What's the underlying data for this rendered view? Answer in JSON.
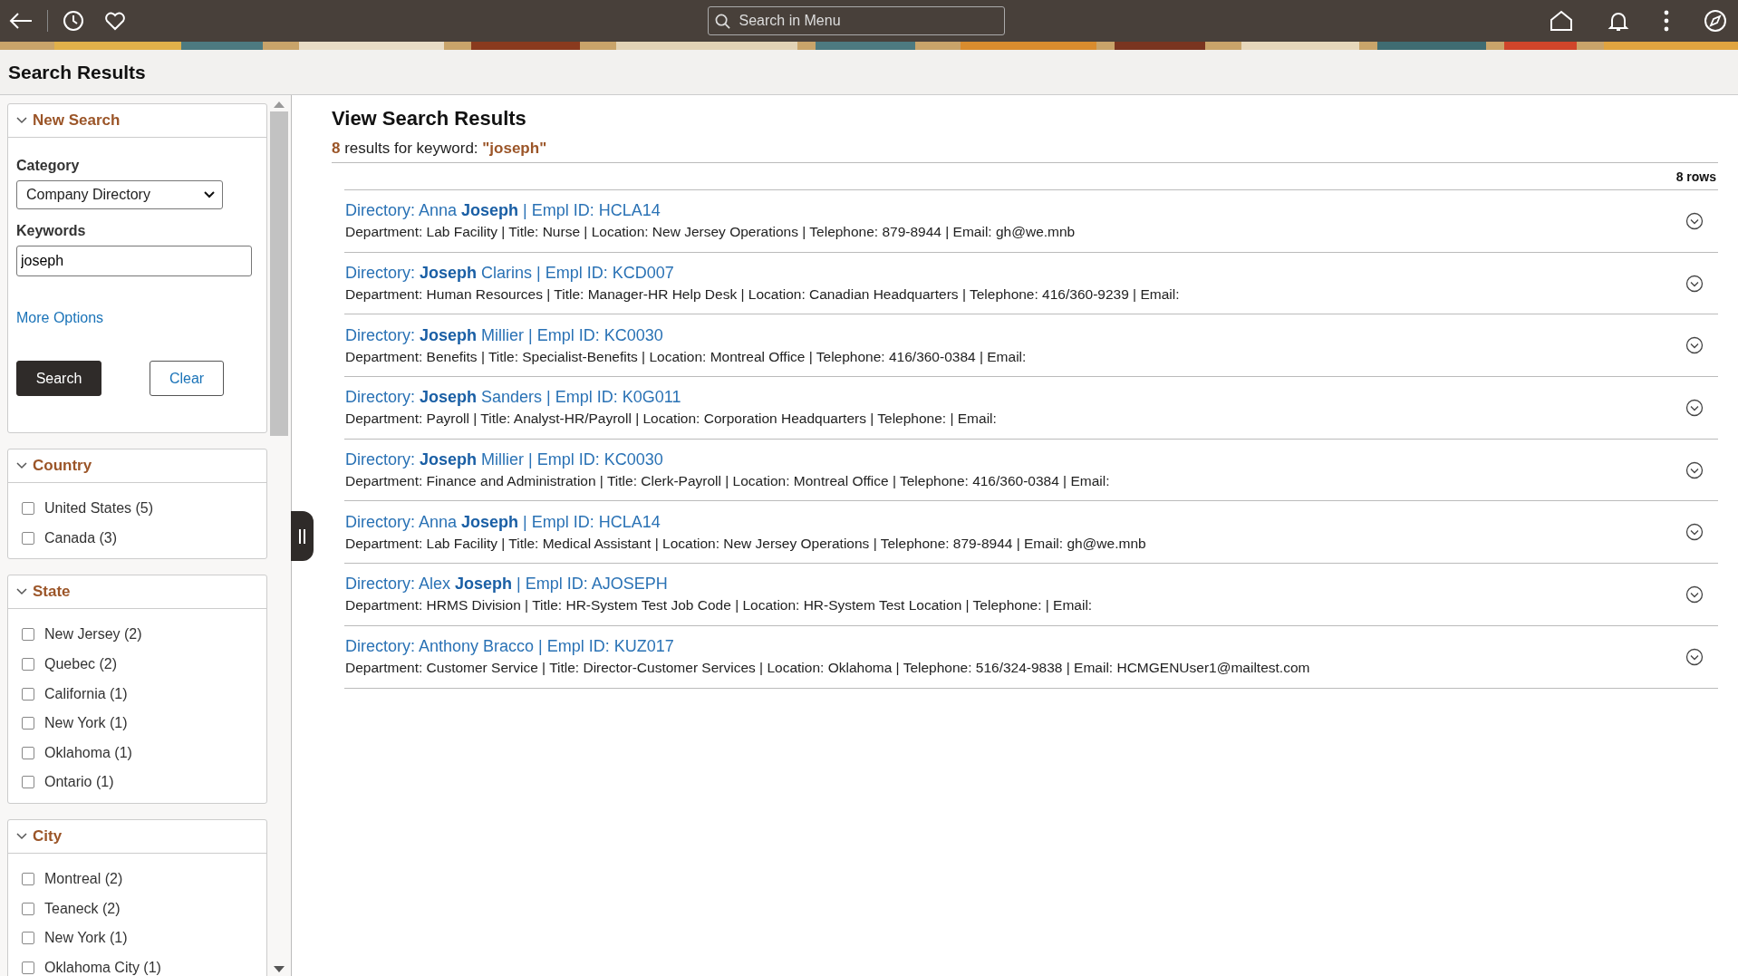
{
  "top_bar": {
    "search": {
      "placeholder": "Search in Menu"
    }
  },
  "page_title": "Search Results",
  "sidebar": {
    "new_search": {
      "title": "New Search",
      "expanded": true,
      "category_label": "Category",
      "category_value": "Company Directory",
      "keywords_label": "Keywords",
      "keywords_value": "joseph",
      "more_options": "More Options",
      "search_button": "Search",
      "clear_button": "Clear"
    },
    "facets": [
      {
        "title": "Country",
        "expanded": true,
        "items": [
          {
            "label": "United States (5)",
            "checked": false
          },
          {
            "label": "Canada (3)",
            "checked": false
          }
        ]
      },
      {
        "title": "State",
        "expanded": true,
        "items": [
          {
            "label": "New Jersey (2)",
            "checked": false
          },
          {
            "label": "Quebec (2)",
            "checked": false
          },
          {
            "label": "California (1)",
            "checked": false
          },
          {
            "label": "New York (1)",
            "checked": false
          },
          {
            "label": "Oklahoma (1)",
            "checked": false
          },
          {
            "label": "Ontario (1)",
            "checked": false
          }
        ]
      },
      {
        "title": "City",
        "expanded": true,
        "items": [
          {
            "label": "Montreal (2)",
            "checked": false
          },
          {
            "label": "Teaneck (2)",
            "checked": false
          },
          {
            "label": "New York (1)",
            "checked": false
          },
          {
            "label": "Oklahoma City (1)",
            "checked": false
          }
        ]
      }
    ]
  },
  "results": {
    "title": "View Search Results",
    "summary": {
      "count": "8",
      "text": "results for keyword:",
      "keyword": "\"joseph\""
    },
    "row_count": "8 rows",
    "rows": [
      {
        "title": "Directory: Anna **Joseph** | Empl ID: HCLA14",
        "details": "Department: Lab Facility | Title: Nurse | Location: New Jersey Operations | Telephone: 879-8944 | Email: gh@we.mnb"
      },
      {
        "title": "Directory: **Joseph** Clarins | Empl ID: KCD007",
        "details": "Department: Human Resources | Title: Manager-HR Help Desk | Location: Canadian Headquarters | Telephone: 416/360-9239 | Email:"
      },
      {
        "title": "Directory: **Joseph** Millier | Empl ID: KC0030",
        "details": "Department: Benefits | Title: Specialist-Benefits | Location: Montreal Office | Telephone: 416/360-0384 | Email:"
      },
      {
        "title": "Directory: **Joseph** Sanders | Empl ID: K0G011",
        "details": "Department: Payroll | Title: Analyst-HR/Payroll | Location: Corporation Headquarters | Telephone: | Email:"
      },
      {
        "title": "Directory: **Joseph** Millier | Empl ID: KC0030",
        "details": "Department: Finance and Administration | Title: Clerk-Payroll | Location: Montreal Office | Telephone: 416/360-0384 | Email:"
      },
      {
        "title": "Directory: Anna **Joseph** | Empl ID: HCLA14",
        "details": "Department: Lab Facility | Title: Medical Assistant | Location: New Jersey Operations | Telephone: 879-8944 | Email: gh@we.mnb"
      },
      {
        "title": "Directory: Alex **Joseph** | Empl ID: AJOSEPH",
        "details": "Department: HRMS Division | Title: HR-System Test Job Code | Location: HR-System Test Location | Telephone: | Email:"
      },
      {
        "title": "Directory: Anthony Bracco | Empl ID: KUZ017",
        "details": "Department: Customer Service | Title: Director-Customer Services | Location: Oklahoma | Telephone: 516/324-9838 | Email: HCMGENUser1@mailtest.com"
      }
    ]
  }
}
